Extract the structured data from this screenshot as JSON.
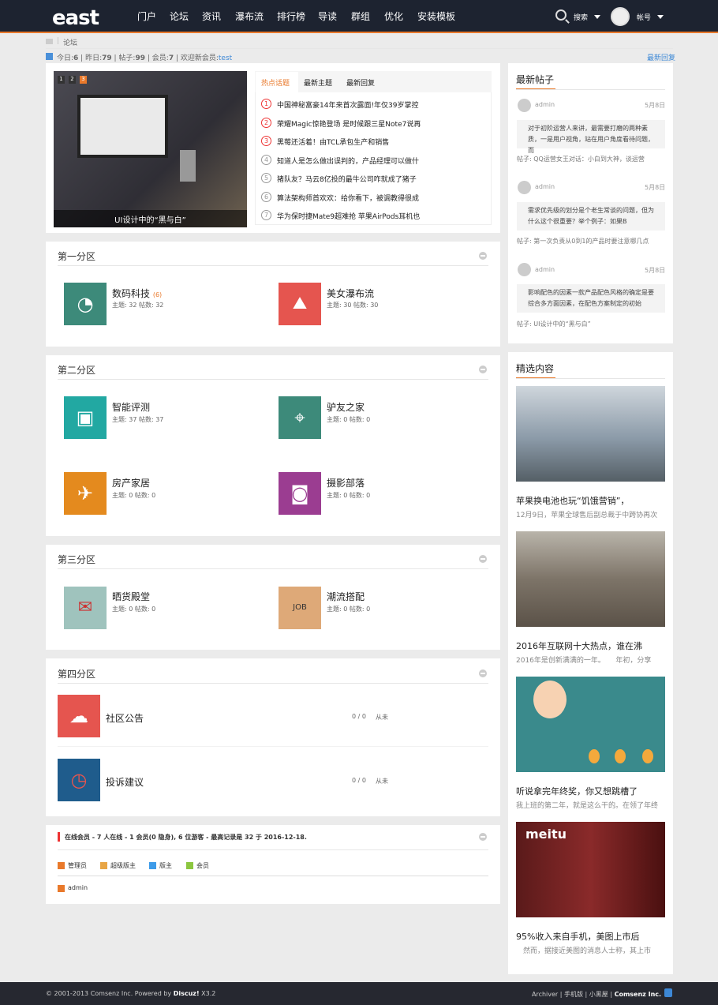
{
  "header": {
    "logo_text": "east",
    "nav": [
      "门户",
      "论坛",
      "资讯",
      "瀑布流",
      "排行榜",
      "导读",
      "群组",
      "优化",
      "安装模板"
    ],
    "search_label": "搜索",
    "account_label": "帐号"
  },
  "breadcrumb": {
    "current": "论坛"
  },
  "stats": {
    "today_label": "今日:",
    "today": "6",
    "yesterday_label": "昨日:",
    "yesterday": "79",
    "posts_label": "帖子:",
    "posts": "99",
    "members_label": "会员:",
    "members": "7",
    "welcome_label": "欢迎新会员:",
    "new_member": "test",
    "latest_link": "最新回复"
  },
  "slider": {
    "pages": [
      "1",
      "2",
      "3"
    ],
    "caption": "UI设计中的“黑与白”"
  },
  "hot_tabs": [
    "热点话题",
    "最新主题",
    "最新回复"
  ],
  "hot_items": [
    {
      "n": "1",
      "text": "中国神秘富豪14年来首次露面!年仅39岁掌控"
    },
    {
      "n": "2",
      "text": "荣耀Magic惊艳登场 是时候跟三星Note7说再"
    },
    {
      "n": "3",
      "text": "黑莓还活着！由TCL承包生产和销售"
    },
    {
      "n": "4",
      "text": "知道人是怎么做出误判的，产品经理可以做什"
    },
    {
      "n": "5",
      "text": "猪队友？马云8亿投的最牛公司咋就成了猪子"
    },
    {
      "n": "6",
      "text": "算法架构师首欢欢：给你看下，被调教得很成"
    },
    {
      "n": "7",
      "text": "华为保时捷Mate9超难抢 苹果AirPods耳机也"
    }
  ],
  "zones": [
    {
      "title": "第一分区",
      "forums": [
        {
          "name": "数码科技",
          "badge": "(6)",
          "meta": "主题: 32 帖数: 32",
          "color": "#3d8a7a",
          "glyph": "◔"
        },
        {
          "name": "美女瀑布流",
          "badge": "",
          "meta": "主题: 30 帖数: 30",
          "color": "#e5554f",
          "glyph": "⛰"
        }
      ]
    },
    {
      "title": "第二分区",
      "forums": [
        {
          "name": "智能评测",
          "badge": "",
          "meta": "主题: 37 帖数: 37",
          "color": "#22a8a2",
          "glyph": "▣"
        },
        {
          "name": "驴友之家",
          "badge": "",
          "meta": "主题: 0 帖数: 0",
          "color": "#3d8a7a",
          "glyph": "⌖"
        },
        {
          "name": "房产家居",
          "badge": "",
          "meta": "主题: 0 帖数: 0",
          "color": "#e48a1e",
          "glyph": "✈"
        },
        {
          "name": "摄影部落",
          "badge": "",
          "meta": "主题: 0 帖数: 0",
          "color": "#9b3d91",
          "glyph": "◙"
        }
      ]
    },
    {
      "title": "第三分区",
      "forums": [
        {
          "name": "晒货殿堂",
          "badge": "",
          "meta": "主题: 0 帖数: 0",
          "color": "#9fc3bd",
          "glyph": "✉"
        },
        {
          "name": "潮流搭配",
          "badge": "",
          "meta": "主题: 0 帖数: 0",
          "color": "#dea978",
          "glyph": "JOB"
        }
      ]
    },
    {
      "title": "第四分区",
      "rows": [
        {
          "name": "社区公告",
          "count": "0 / 0",
          "last": "从未",
          "color": "#e5554f",
          "glyph": "☁"
        },
        {
          "name": "投诉建议",
          "count": "0 / 0",
          "last": "从未",
          "color": "#1f5c8c",
          "glyph": "◷"
        }
      ]
    }
  ],
  "online": {
    "text": "在线会员 - 7 人在线 - 1 会员(0 隐身), 6 位游客 - 最高记录是 32 于 2016-12-18.",
    "legend": [
      {
        "label": "管理员",
        "color": "#e9792b"
      },
      {
        "label": "超级版主",
        "color": "#e8a545"
      },
      {
        "label": "版主",
        "color": "#3d9be9"
      },
      {
        "label": "会员",
        "color": "#8cc63f"
      }
    ],
    "users": [
      "admin"
    ]
  },
  "latest_posts": {
    "title": "最新帖子",
    "items": [
      {
        "user": "admin",
        "date": "5月8日",
        "body": "对于初阶运营人来讲，最需要打磨的两种素质，一是用户视角，站在用户角度看待问题，而",
        "ref": "帖子: QQ运营女王对话：小白到大神，谈运营"
      },
      {
        "user": "admin",
        "date": "5月8日",
        "body": "需求优先级的划分是个老生常谈的问题，但为什么这个很重要？举个例子：如果B",
        "ref": "帖子: 第一次负责从0到1的产品时要注意哪几点"
      },
      {
        "user": "admin",
        "date": "5月8日",
        "body": "影响配色的因素一款产品配色风格的确定是要综合多方面因素，在配色方案制定的初始",
        "ref": "帖子: UI设计中的“黑与白”"
      }
    ]
  },
  "featured": {
    "title": "精选内容",
    "items": [
      {
        "title": "苹果换电池也玩“饥饿营销”，",
        "desc": "12月9日，苹果全球售后副总裁于中跨协再次",
        "bg": "#8b9aa8"
      },
      {
        "title": "2016年互联网十大热点，谁在沸",
        "desc": "2016年是创新满满的一年。　　年初，分享",
        "bg": "#7d7468"
      },
      {
        "title": "听说拿完年终奖，你又想跳槽了",
        "desc": "我上班的第二年，就是这么干的。在领了年终",
        "bg": "#3a8a8c"
      },
      {
        "title": "95%收入来自手机，美图上市后",
        "desc": "　然而，据接近美图的消息人士称，其上市",
        "bg": "#6b2020"
      }
    ]
  },
  "footer": {
    "copyright": "© 2001-2013 Comsenz Inc.  Powered by ",
    "brand": "Discuz!",
    "version": " X3.2",
    "links": "Archiver | 手机版 | 小黑屋 | ",
    "company": "Comsenz Inc."
  }
}
